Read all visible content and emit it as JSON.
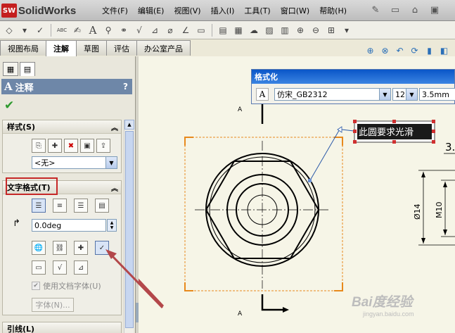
{
  "app": {
    "logo_badge": "SW",
    "name": "SolidWorks"
  },
  "menu": [
    "文件(F)",
    "编辑(E)",
    "视图(V)",
    "插入(I)",
    "工具(T)",
    "窗口(W)",
    "帮助(H)"
  ],
  "tabs": [
    {
      "label": "视图布局",
      "active": false
    },
    {
      "label": "注解",
      "active": true
    },
    {
      "label": "草图",
      "active": false
    },
    {
      "label": "评估",
      "active": false
    },
    {
      "label": "办公室产品",
      "active": false
    }
  ],
  "toolbar": {
    "text_tool_glyph": "A",
    "abc_glyph": "ABC",
    "check_label": "√"
  },
  "property_manager": {
    "title_icon": "A",
    "title": "注释",
    "help": "?",
    "ok_glyph": "✔"
  },
  "style_group": {
    "title": "样式(S)",
    "style_value": "<无>"
  },
  "text_format_group": {
    "title": "文字格式(T)",
    "angle_value": "0.0deg",
    "use_doc_font_label": "使用文档字体(U)",
    "font_button_label": "字体(N)..."
  },
  "leader_group": {
    "title": "引线(L)"
  },
  "format_dialog": {
    "title": "格式化",
    "font_value": "仿宋_GB2312",
    "size_value": "12",
    "height_value": "3.5mm"
  },
  "drawing": {
    "section_label_top": "A",
    "section_label_bottom": "A",
    "note_text": "此圆要求光滑",
    "dim_label": "3.",
    "dim_diameter": "Ø14",
    "dim_thread": "M10"
  },
  "watermark": {
    "brand": "Bai度经验",
    "url": "jingyan.baidu.com"
  },
  "colors": {
    "accent_red": "#c62828",
    "selection_orange": "#e8891c",
    "title_blue": "#0a56c8",
    "arrow": "#b3474a"
  }
}
